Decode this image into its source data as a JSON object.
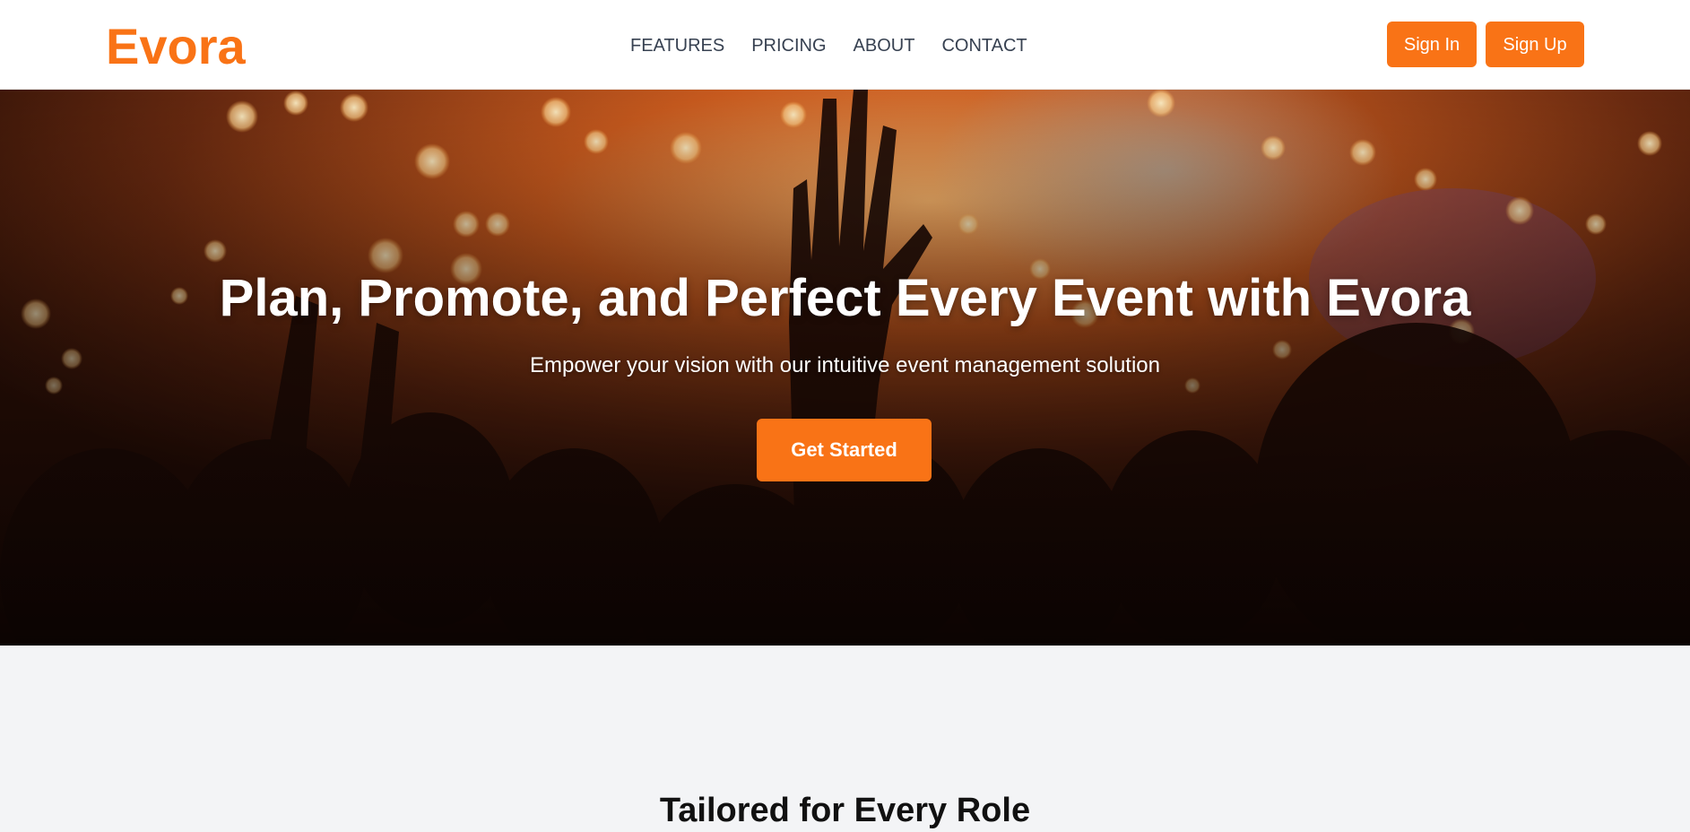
{
  "brand": {
    "name": "Evora"
  },
  "nav": {
    "links": [
      "FEATURES",
      "PRICING",
      "ABOUT",
      "CONTACT"
    ]
  },
  "auth": {
    "sign_in": "Sign In",
    "sign_up": "Sign Up"
  },
  "hero": {
    "background": "concert-crowd-photo",
    "title": "Plan, Promote, and Perfect Every Event with Evora",
    "subtitle": "Empower your vision with our intuitive event management solution",
    "cta": "Get Started"
  },
  "section": {
    "title": "Tailored for Every Role"
  },
  "colors": {
    "accent": "#f97316",
    "nav_text": "#374151",
    "section_bg": "#f3f4f6"
  }
}
